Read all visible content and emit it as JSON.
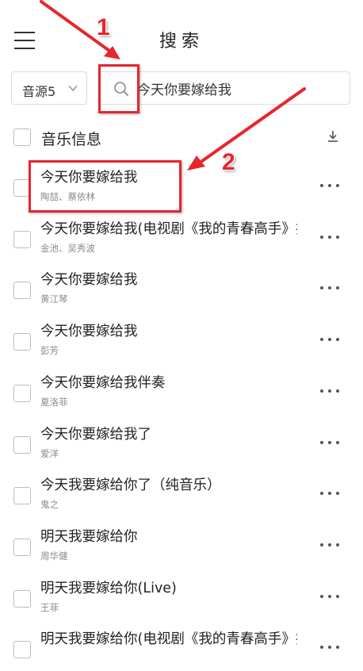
{
  "header": {
    "title": "搜索",
    "menu_icon": "hamburger-menu-icon"
  },
  "search": {
    "source_label": "音源5",
    "query": "今天你要嫁给我"
  },
  "list_header": {
    "label": "音乐信息",
    "download_icon": "download-icon"
  },
  "songs": [
    {
      "title": "今天你要嫁给我",
      "artist": "陶喆、蔡依林"
    },
    {
      "title": "今天你要嫁给我(电视剧《我的青春高手》插曲)",
      "artist": "金池、吴秀波"
    },
    {
      "title": "今天你要嫁给我",
      "artist": "黄江琴"
    },
    {
      "title": "今天你要嫁给我",
      "artist": "彭芳"
    },
    {
      "title": "今天你要嫁给我伴奏",
      "artist": "夏洛菲"
    },
    {
      "title": "今天你要嫁给我了",
      "artist": "爱洋"
    },
    {
      "title": "今天我要嫁给你了（纯音乐）",
      "artist": "鬼之"
    },
    {
      "title": "明天我要嫁给你",
      "artist": "周华健"
    },
    {
      "title": "明天我要嫁给你(Live)",
      "artist": "王菲"
    },
    {
      "title": "明天我要嫁给你(电视剧《我的青春高手》插曲)",
      "artist": ""
    }
  ],
  "annotations": {
    "step1": "1",
    "step2": "2",
    "color": "#e8252c"
  }
}
